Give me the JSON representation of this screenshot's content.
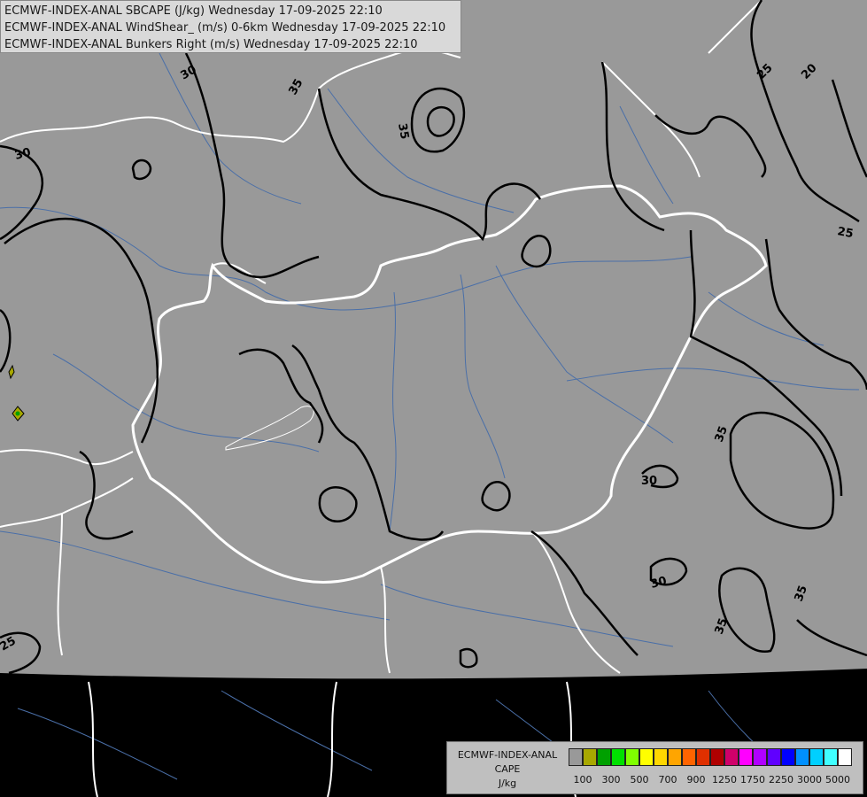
{
  "header": {
    "line1": "ECMWF-INDEX-ANAL SBCAPE (J/kg) Wednesday 17-09-2025 22:10",
    "line2": "ECMWF-INDEX-ANAL WindShear_ (m/s) 0-6km Wednesday 17-09-2025 22:10",
    "line3": "ECMWF-INDEX-ANAL Bunkers Right (m/s) Wednesday 17-09-2025 22:10"
  },
  "colors": {
    "land": "#999999",
    "outside": "#000000",
    "contour": "#000000",
    "border": "#ffffff",
    "river": "#4a6fa8"
  },
  "contour_labels": {
    "l30a": "30",
    "l35a": "35",
    "l35b": "35",
    "l30b": "30",
    "l25a": "25",
    "l20": "20",
    "l25b": "25",
    "l35c": "35",
    "l30c": "30",
    "l30d": "30",
    "l35d": "35",
    "l35e": "35",
    "l25c": "25"
  },
  "legend": {
    "title_line1": "ECMWF-INDEX-ANAL",
    "title_line2": "CAPE",
    "unit": "J/kg",
    "swatch_colors": [
      "#999999",
      "#a8a800",
      "#00a000",
      "#00e000",
      "#80ff00",
      "#ffff00",
      "#ffd700",
      "#ffa500",
      "#ff6400",
      "#e03000",
      "#b00000",
      "#d0006a",
      "#ff00ff",
      "#b000ff",
      "#6000ff",
      "#0000ff",
      "#0090ff",
      "#00d0ff",
      "#40ffff",
      "#ffffff"
    ],
    "tick_labels": [
      "100",
      "300",
      "500",
      "700",
      "900",
      "1250",
      "1750",
      "2250",
      "3000",
      "5000"
    ]
  }
}
